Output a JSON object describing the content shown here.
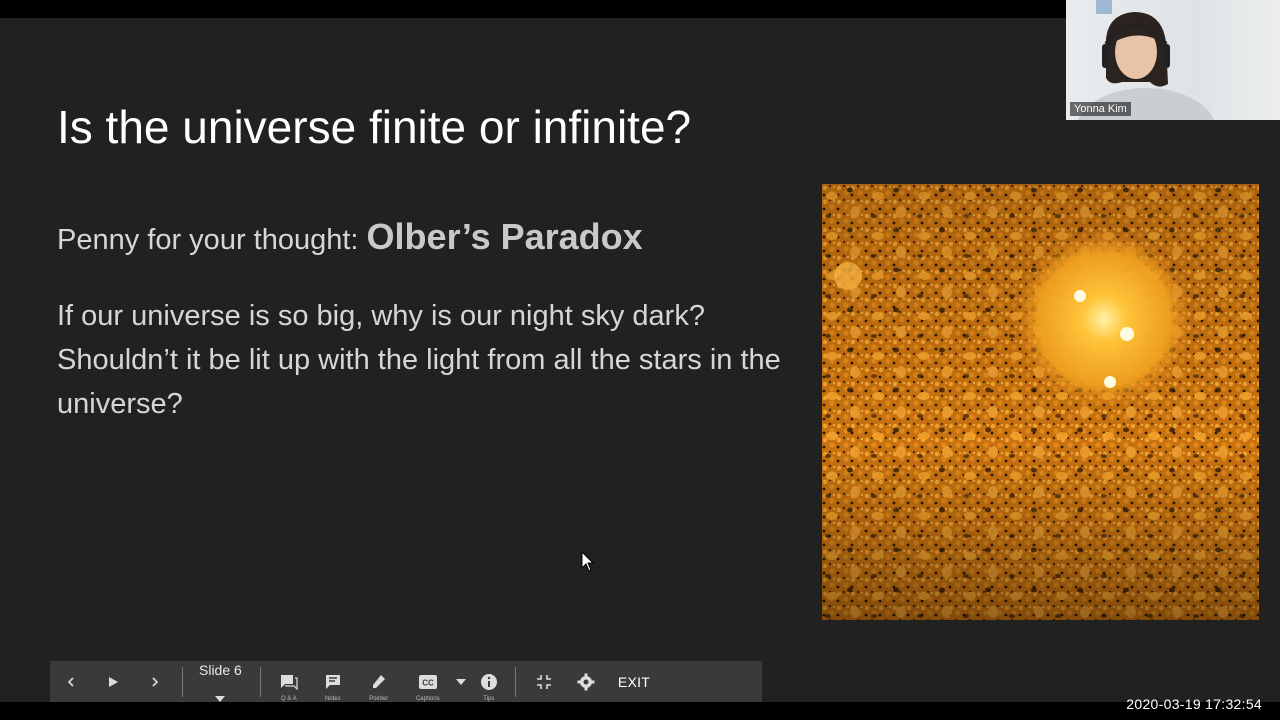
{
  "slide": {
    "title": "Is the universe finite or infinite?",
    "penny_prefix": "Penny for your thought:",
    "penny_bold": "Olber’s Paradox",
    "body": "If our universe is so big, why is our night sky dark? Shouldn’t it be lit up with the light from all the stars in the universe?"
  },
  "participant": {
    "name": "Yonna Kim"
  },
  "toolbar": {
    "slide_label": "Slide 6",
    "qa_label": "Q & A",
    "notes_label": "Notes",
    "pointer_label": "Pointer",
    "captions_label": "Captions",
    "tips_label": "Tips",
    "exit_label": "EXIT"
  },
  "timestamp": "2020-03-19  17:32:54",
  "colors": {
    "slide_bg": "#212121",
    "toolbar_bg": "#3a3a3a",
    "sun_orange": "#e6921e"
  }
}
